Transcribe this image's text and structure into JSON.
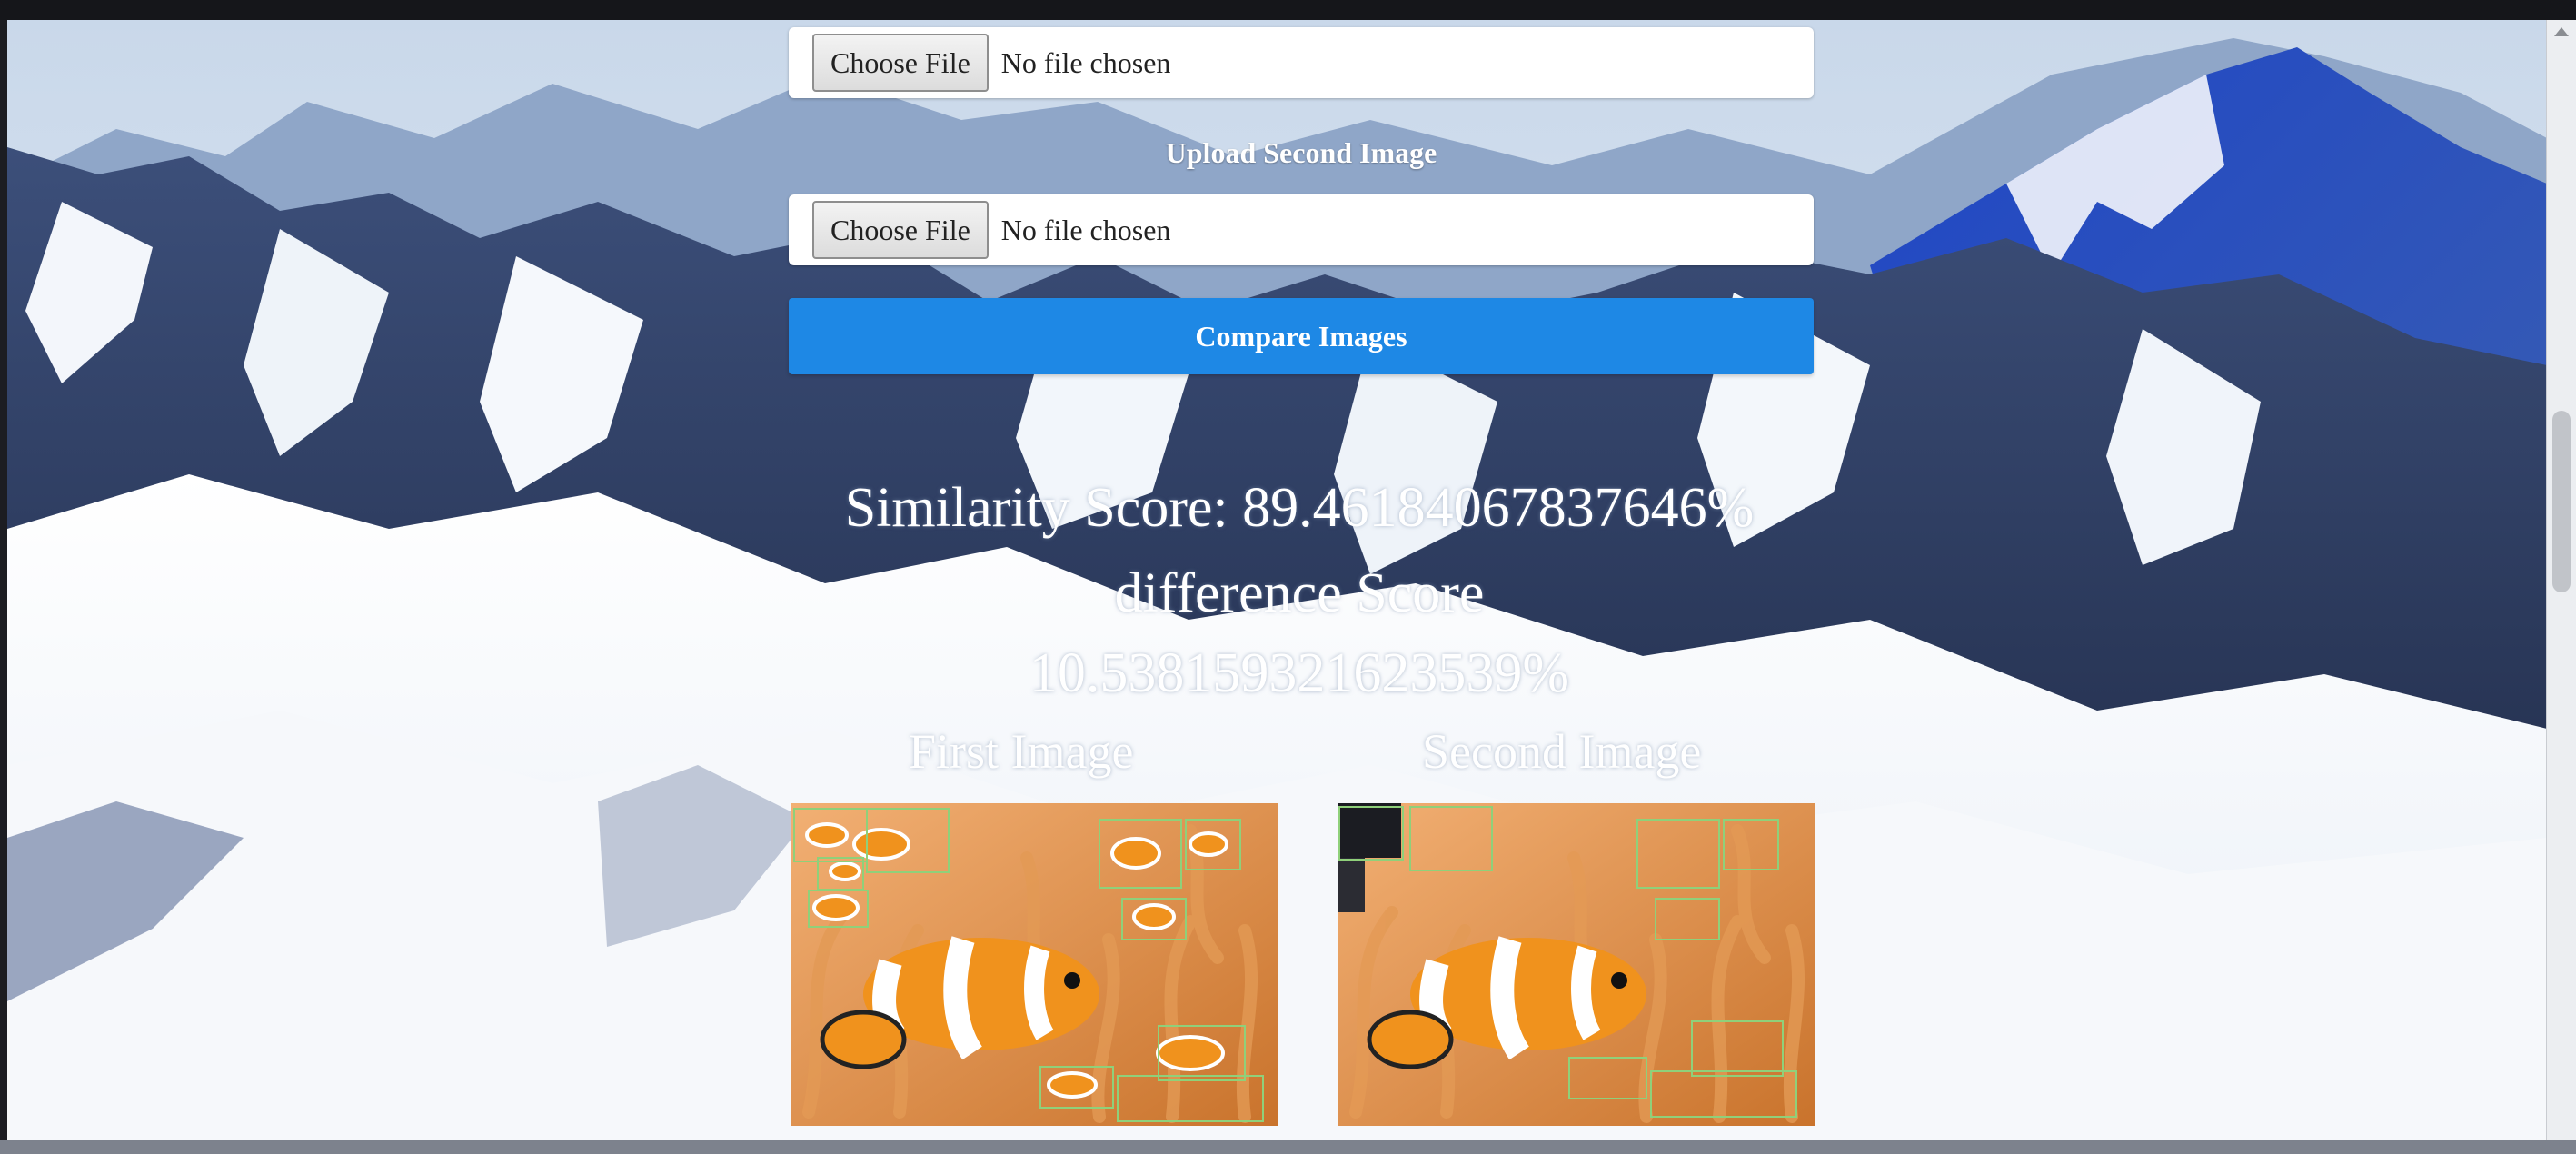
{
  "upload_first": {
    "button_label": "Choose File",
    "status": "No file chosen"
  },
  "upload_second": {
    "label": "Upload Second Image",
    "button_label": "Choose File",
    "status": "No file chosen"
  },
  "compare_button": "Compare Images",
  "results": {
    "similarity_text": "Similarity Score: 89.46184067837646%",
    "difference_label": "difference Score",
    "difference_value": "10.538159321623539%"
  },
  "images": {
    "first_caption": "First Image",
    "second_caption": "Second Image"
  },
  "colors": {
    "accent_button": "#1e88e5",
    "score_text": "#ffffff",
    "box_highlight": "#8fd07a"
  }
}
